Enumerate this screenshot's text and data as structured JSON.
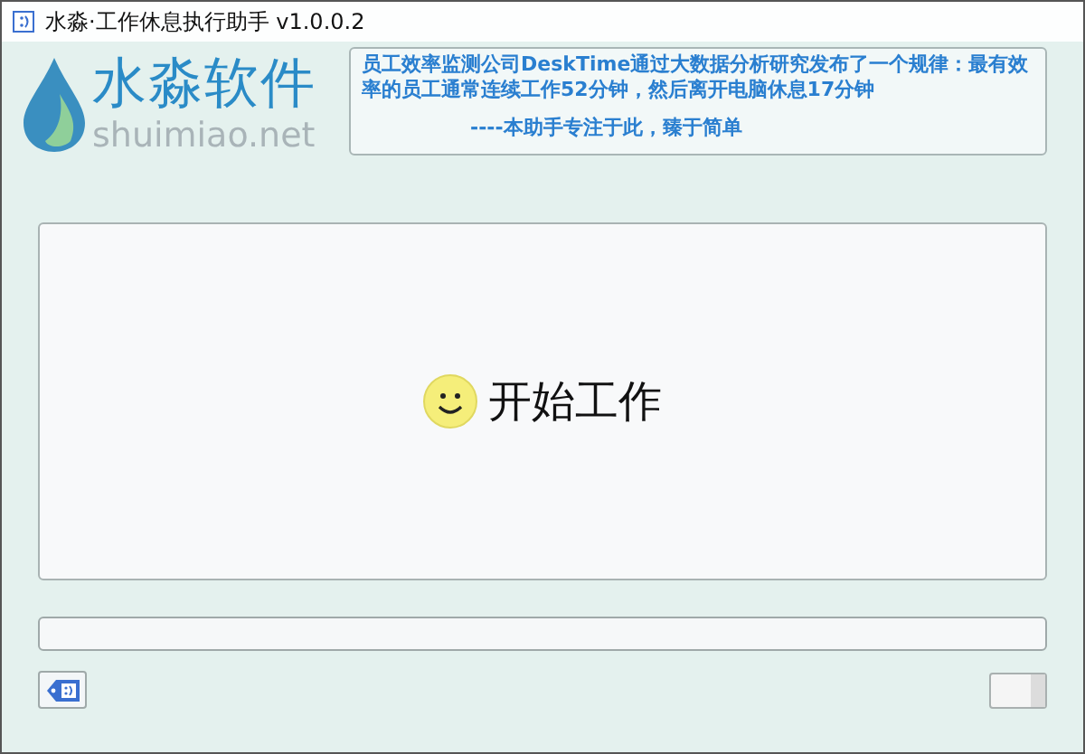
{
  "window": {
    "title": "水淼·工作休息执行助手 v1.0.0.2"
  },
  "logo": {
    "name": "水淼软件",
    "site": "shuimiao.net"
  },
  "notice": {
    "text": "员工效率监测公司DeskTime通过大数据分析研究发布了一个规律：最有效率的员工通常连续工作52分钟，然后离开电脑休息17分钟",
    "signature": "----本助手专注于此，臻于简单"
  },
  "start_button": {
    "label": "开始工作"
  },
  "toggle": {
    "on": false
  }
}
